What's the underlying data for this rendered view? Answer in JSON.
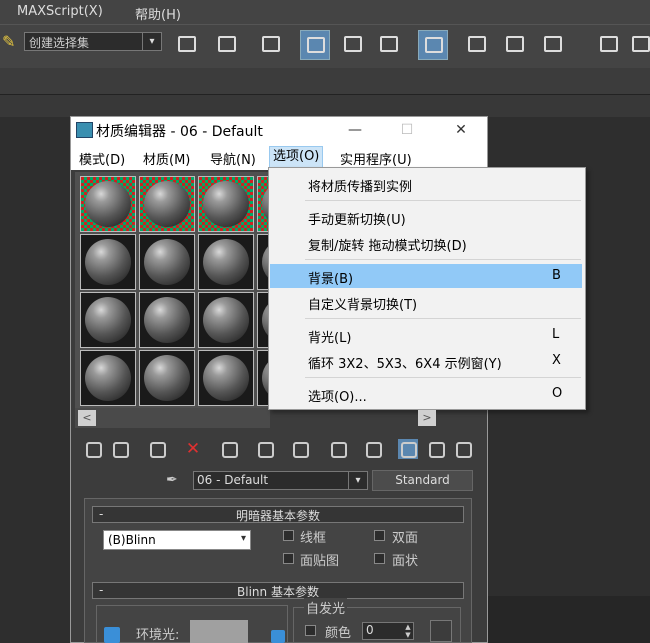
{
  "app_menu": {
    "maxscript": "MAXScript(X)",
    "help": "帮助(H)"
  },
  "toolbar": {
    "selection_set_value": "创建选择集",
    "dropdown_glyph": "▾"
  },
  "window": {
    "title": "材质编辑器 - 06 - Default",
    "minimize": "—",
    "maximize": "☐",
    "close": "✕"
  },
  "menu": {
    "items": [
      "模式(D)",
      "材质(M)",
      "导航(N)",
      "选项(O)",
      "实用程序(U)"
    ]
  },
  "options_dropdown": {
    "items": [
      {
        "label": "将材质传播到实例",
        "key": ""
      },
      {
        "label": "手动更新切换(U)",
        "key": ""
      },
      {
        "label": "复制/旋转 拖动模式切换(D)",
        "key": ""
      },
      {
        "label": "背景(B)",
        "key": "B",
        "highlighted": true
      },
      {
        "label": "自定义背景切换(T)",
        "key": ""
      },
      {
        "label": "背光(L)",
        "key": "L"
      },
      {
        "label": "循环 3X2、5X3、6X4 示例窗(Y)",
        "key": "X"
      },
      {
        "label": "选项(O)...",
        "key": "O"
      }
    ]
  },
  "scroll": {
    "left": "<",
    "right": ">"
  },
  "material": {
    "name": "06 - Default",
    "type_button": "Standard"
  },
  "shader_rollout": {
    "title": "明暗器基本参数",
    "minus": "-",
    "shader": "(B)Blinn",
    "checks": {
      "wire": "线框",
      "two_sided": "双面",
      "face_map": "面贴图",
      "faceted": "面状"
    }
  },
  "blinn_rollout": {
    "title": "Blinn 基本参数",
    "minus": "-",
    "self_illum": "自发光",
    "color_label": "颜色",
    "color_value": "0",
    "ambient": "环境光:"
  }
}
